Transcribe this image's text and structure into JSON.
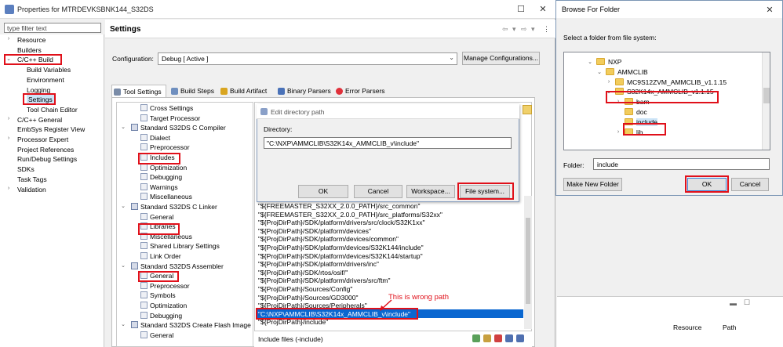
{
  "prop_window": {
    "title": "Properties for MTRDEVKSBNK144_S32DS",
    "filter_placeholder": "type filter text",
    "tree": [
      {
        "label": "Resource",
        "twisty": "›"
      },
      {
        "label": "Builders",
        "twisty": ""
      },
      {
        "label": "C/C++ Build",
        "twisty": "⌄"
      },
      {
        "label": "Build Variables",
        "twisty": ""
      },
      {
        "label": "Environment",
        "twisty": ""
      },
      {
        "label": "Logging",
        "twisty": ""
      },
      {
        "label": "Settings",
        "twisty": ""
      },
      {
        "label": "Tool Chain Editor",
        "twisty": ""
      },
      {
        "label": "C/C++ General",
        "twisty": "›"
      },
      {
        "label": "EmbSys Register View",
        "twisty": ""
      },
      {
        "label": "Processor Expert",
        "twisty": "›"
      },
      {
        "label": "Project References",
        "twisty": ""
      },
      {
        "label": "Run/Debug Settings",
        "twisty": ""
      },
      {
        "label": "SDKs",
        "twisty": ""
      },
      {
        "label": "Task Tags",
        "twisty": ""
      },
      {
        "label": "Validation",
        "twisty": "›"
      }
    ],
    "settings_title": "Settings",
    "configuration_label": "Configuration:",
    "configuration_value": "Debug  [ Active ]",
    "manage_button": "Manage Configurations...",
    "tabs": [
      "Tool Settings",
      "Build Steps",
      "Build Artifact",
      "Binary Parsers",
      "Error Parsers"
    ],
    "tool_tree": [
      {
        "label": "Cross Settings",
        "type": "g"
      },
      {
        "label": "Target Processor",
        "type": "g"
      },
      {
        "label": "Standard S32DS C Compiler",
        "type": "c"
      },
      {
        "label": "Dialect",
        "type": "g"
      },
      {
        "label": "Preprocessor",
        "type": "g"
      },
      {
        "label": "Includes",
        "type": "g"
      },
      {
        "label": "Optimization",
        "type": "g"
      },
      {
        "label": "Debugging",
        "type": "g"
      },
      {
        "label": "Warnings",
        "type": "g"
      },
      {
        "label": "Miscellaneous",
        "type": "g"
      },
      {
        "label": "Standard S32DS C Linker",
        "type": "c"
      },
      {
        "label": "General",
        "type": "g"
      },
      {
        "label": "Libraries",
        "type": "g"
      },
      {
        "label": "Miscellaneous",
        "type": "g"
      },
      {
        "label": "Shared Library Settings",
        "type": "g"
      },
      {
        "label": "Link Order",
        "type": "g"
      },
      {
        "label": "Standard S32DS Assembler",
        "type": "c"
      },
      {
        "label": "General",
        "type": "g"
      },
      {
        "label": "Preprocessor",
        "type": "g"
      },
      {
        "label": "Symbols",
        "type": "g"
      },
      {
        "label": "Optimization",
        "type": "g"
      },
      {
        "label": "Debugging",
        "type": "g"
      },
      {
        "label": "Standard S32DS Create Flash Image",
        "type": "c"
      },
      {
        "label": "General",
        "type": "g"
      }
    ],
    "include_paths": [
      "\"${FREEMASTER_S32XX_2.0.0_PATH}/src_common\"",
      "\"${FREEMASTER_S32XX_2.0.0_PATH}/src_platforms/S32xx\"",
      "\"${ProjDirPath}/SDK/platform/drivers/src/clock/S32K1xx\"",
      "\"${ProjDirPath}/SDK/platform/devices\"",
      "\"${ProjDirPath}/SDK/platform/devices/common\"",
      "\"${ProjDirPath}/SDK/platform/devices/S32K144/include\"",
      "\"${ProjDirPath}/SDK/platform/devices/S32K144/startup\"",
      "\"${ProjDirPath}/SDK/platform/drivers/inc\"",
      "\"${ProjDirPath}/SDK/rtos/osif/\"",
      "\"${ProjDirPath}/SDK/platform/drivers/src/ftm\"",
      "\"${ProjDirPath}/Sources/Config\"",
      "\"${ProjDirPath}/Sources/GD3000\"",
      "\"${ProjDirPath}/Sources/Peripherals\"",
      "\"C:\\NXP\\AMMCLIB\\S32K14x_AMMCLIB_v\\include\"",
      "\"${ProjDirPath}/include\""
    ],
    "include_footer": "Include files (-include)",
    "annotation": "This is wrong path"
  },
  "edit_dialog": {
    "title": "Edit directory path",
    "directory_label": "Directory:",
    "directory_value": "\"C:\\NXP\\AMMCLIB\\S32K14x_AMMCLIB_v\\include\"",
    "ok": "OK",
    "cancel": "Cancel",
    "workspace": "Workspace...",
    "filesystem": "File system..."
  },
  "browse_dialog": {
    "title": "Browse For Folder",
    "instruction": "Select a folder from file system:",
    "tree": [
      {
        "label": "NXP",
        "twisty": "⌄"
      },
      {
        "label": "AMMCLIB",
        "twisty": "⌄"
      },
      {
        "label": "MC9S12ZVM_AMMCLIB_v1.1.15",
        "twisty": "›"
      },
      {
        "label": "S32K14x_AMMCLIB_v1.1.15",
        "twisty": "⌄"
      },
      {
        "label": "bam",
        "twisty": "›"
      },
      {
        "label": "doc",
        "twisty": ""
      },
      {
        "label": "include",
        "twisty": ""
      },
      {
        "label": "lib",
        "twisty": "›"
      }
    ],
    "folder_label": "Folder:",
    "folder_value": "include",
    "make_new_folder": "Make New Folder",
    "ok": "OK",
    "cancel": "Cancel"
  },
  "background_table": {
    "columns": [
      "Resource",
      "Path"
    ]
  }
}
